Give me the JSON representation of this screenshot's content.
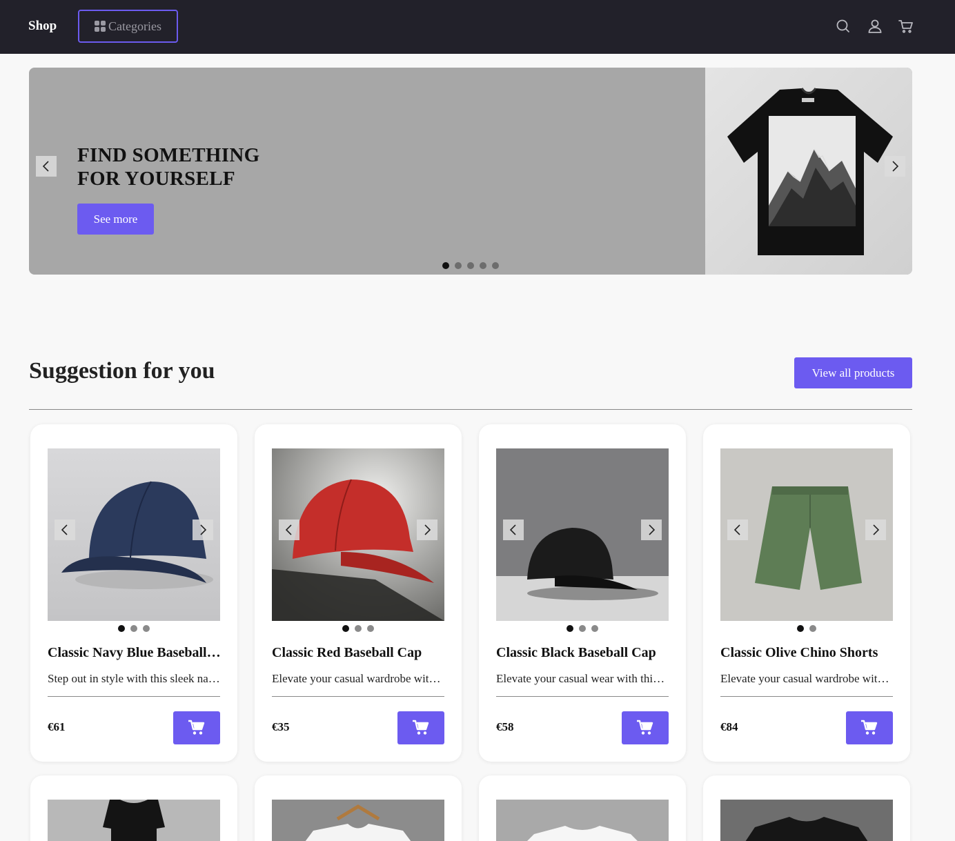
{
  "header": {
    "brand": "Shop",
    "categories_label": "Categories",
    "icons": [
      "search-icon",
      "user-icon",
      "cart-icon"
    ]
  },
  "hero": {
    "title_line1": "FIND SOMETHING",
    "title_line2": "FOR YOURSELF",
    "button_label": "See more",
    "slides": 5,
    "active_slide": 1
  },
  "section": {
    "title": "Suggestion for you",
    "view_all_label": "View all products"
  },
  "products": [
    {
      "name": "Classic Navy Blue Baseball Cap",
      "description": "Step out in style with this sleek navy blue baseball cap.",
      "price": "€61",
      "images": 3,
      "active_image": 1
    },
    {
      "name": "Classic Red Baseball Cap",
      "description": "Elevate your casual wardrobe with this classic red baseball cap.",
      "price": "€35",
      "images": 3,
      "active_image": 1
    },
    {
      "name": "Classic Black Baseball Cap",
      "description": "Elevate your casual wear with this timeless black baseball cap.",
      "price": "€58",
      "images": 3,
      "active_image": 1
    },
    {
      "name": "Classic Olive Chino Shorts",
      "description": "Elevate your casual wardrobe with these olive chino shorts.",
      "price": "€84",
      "images": 2,
      "active_image": 1
    }
  ],
  "colors": {
    "accent": "#6c5bf0",
    "header_bg": "#22212a",
    "hero_bg": "#a7a7a7",
    "page_bg": "#f8f8f8"
  }
}
